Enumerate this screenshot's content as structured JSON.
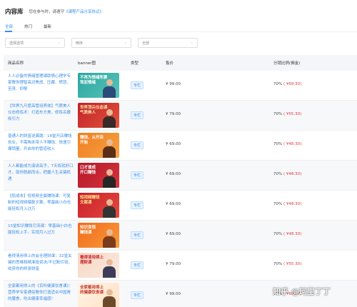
{
  "header": {
    "title": "内容库",
    "notice_prefix": "您在参与时，请遵守",
    "notice_link": "《课程产品分享协议》"
  },
  "tabs": [
    {
      "label": "全部"
    },
    {
      "label": "热门"
    },
    {
      "label": "最新"
    }
  ],
  "filters": {
    "category": "选择选项",
    "sort": "倒序",
    "scope": "全部"
  },
  "columns": {
    "name": "商品名称",
    "banner": "banner图",
    "type": "类型",
    "price": "售价",
    "share": "分销比例(佣金)"
  },
  "rows": [
    {
      "name": "人人必备的情绪管理课助情心理学专家教你理智高对焦虑、压藏、愤怒、苦丧、抑郁",
      "banner_text": "不再为情绪所累\n驾驭情绪",
      "type": "专栏",
      "price": "¥ 99.00",
      "share": "70%",
      "amount": "( ¥69.30)"
    },
    {
      "name": "【世界九尺度高管培养体】气质美人仪态修炼术：打造东方美、修炼名媛吸引力",
      "banner_text": "世界顶尖仪态课\n气质美人",
      "type": "专栏",
      "price": "¥ 79.00",
      "share": "70%",
      "amount": "( ¥55.30)"
    },
    {
      "name": "普通人的财富逆袭路：18堂开店赚钱创业，不需掏本带人不赚钱、快速引爆销量，开启你的管道收入",
      "banner_text": "赚钱，从开店\n开始",
      "type": "专栏",
      "price": "¥ 69.00",
      "share": "70%",
      "amount": "( ¥48.30)"
    },
    {
      "name": "人人都能成为演讲高手，7天练就好口才，助你脱颖而出，把握人生关键机遇",
      "banner_text": "口才速成\n开口赚钱",
      "type": "专栏",
      "price": "¥ 69.00",
      "share": "70%",
      "amount": "( ¥48.30)"
    },
    {
      "name": "【低成本】短视频全赢赚钱课：可复制的短视频爆款文案，零基础小白也能轻松月入过万",
      "banner_text": "短视频赚钱\n文案课",
      "type": "专栏",
      "price": "¥ 69.00",
      "share": "70%",
      "amount": "( ¥48.30)"
    },
    {
      "name": "15堂知识赚钱引流课：零基础小白也能轻松上手，实现月入过万",
      "banner_text": "知识变现\n赚钱课",
      "type": "专栏",
      "price": "¥ 69.00",
      "share": "70%",
      "amount": "( ¥48.30)"
    },
    {
      "name": "看得清用得上的会全理财课：32堂关键的思维和精准投资决/不记账烂钱，收获你的终身财富",
      "banner_text": "看得清用得上\n理财课",
      "type": "专栏",
      "price": "¥ 79.00",
      "share": "70%",
      "amount": "( ¥55.30)"
    },
    {
      "name": "全家都用得上的《百科健康饮食课》：营养学专家通俗教你打造适合中国胃的膳食，吃出健康幸福感！",
      "banner_text": "全家都用得上\n的健康饮食课",
      "type": "专栏",
      "price": "¥ 99.00",
      "share": "70%",
      "amount": "( ¥69.30)"
    }
  ],
  "watermark": "知乎 @珂里丁丁",
  "colors": {
    "accent": "#3a8ee6",
    "commission": "#e0373a"
  }
}
